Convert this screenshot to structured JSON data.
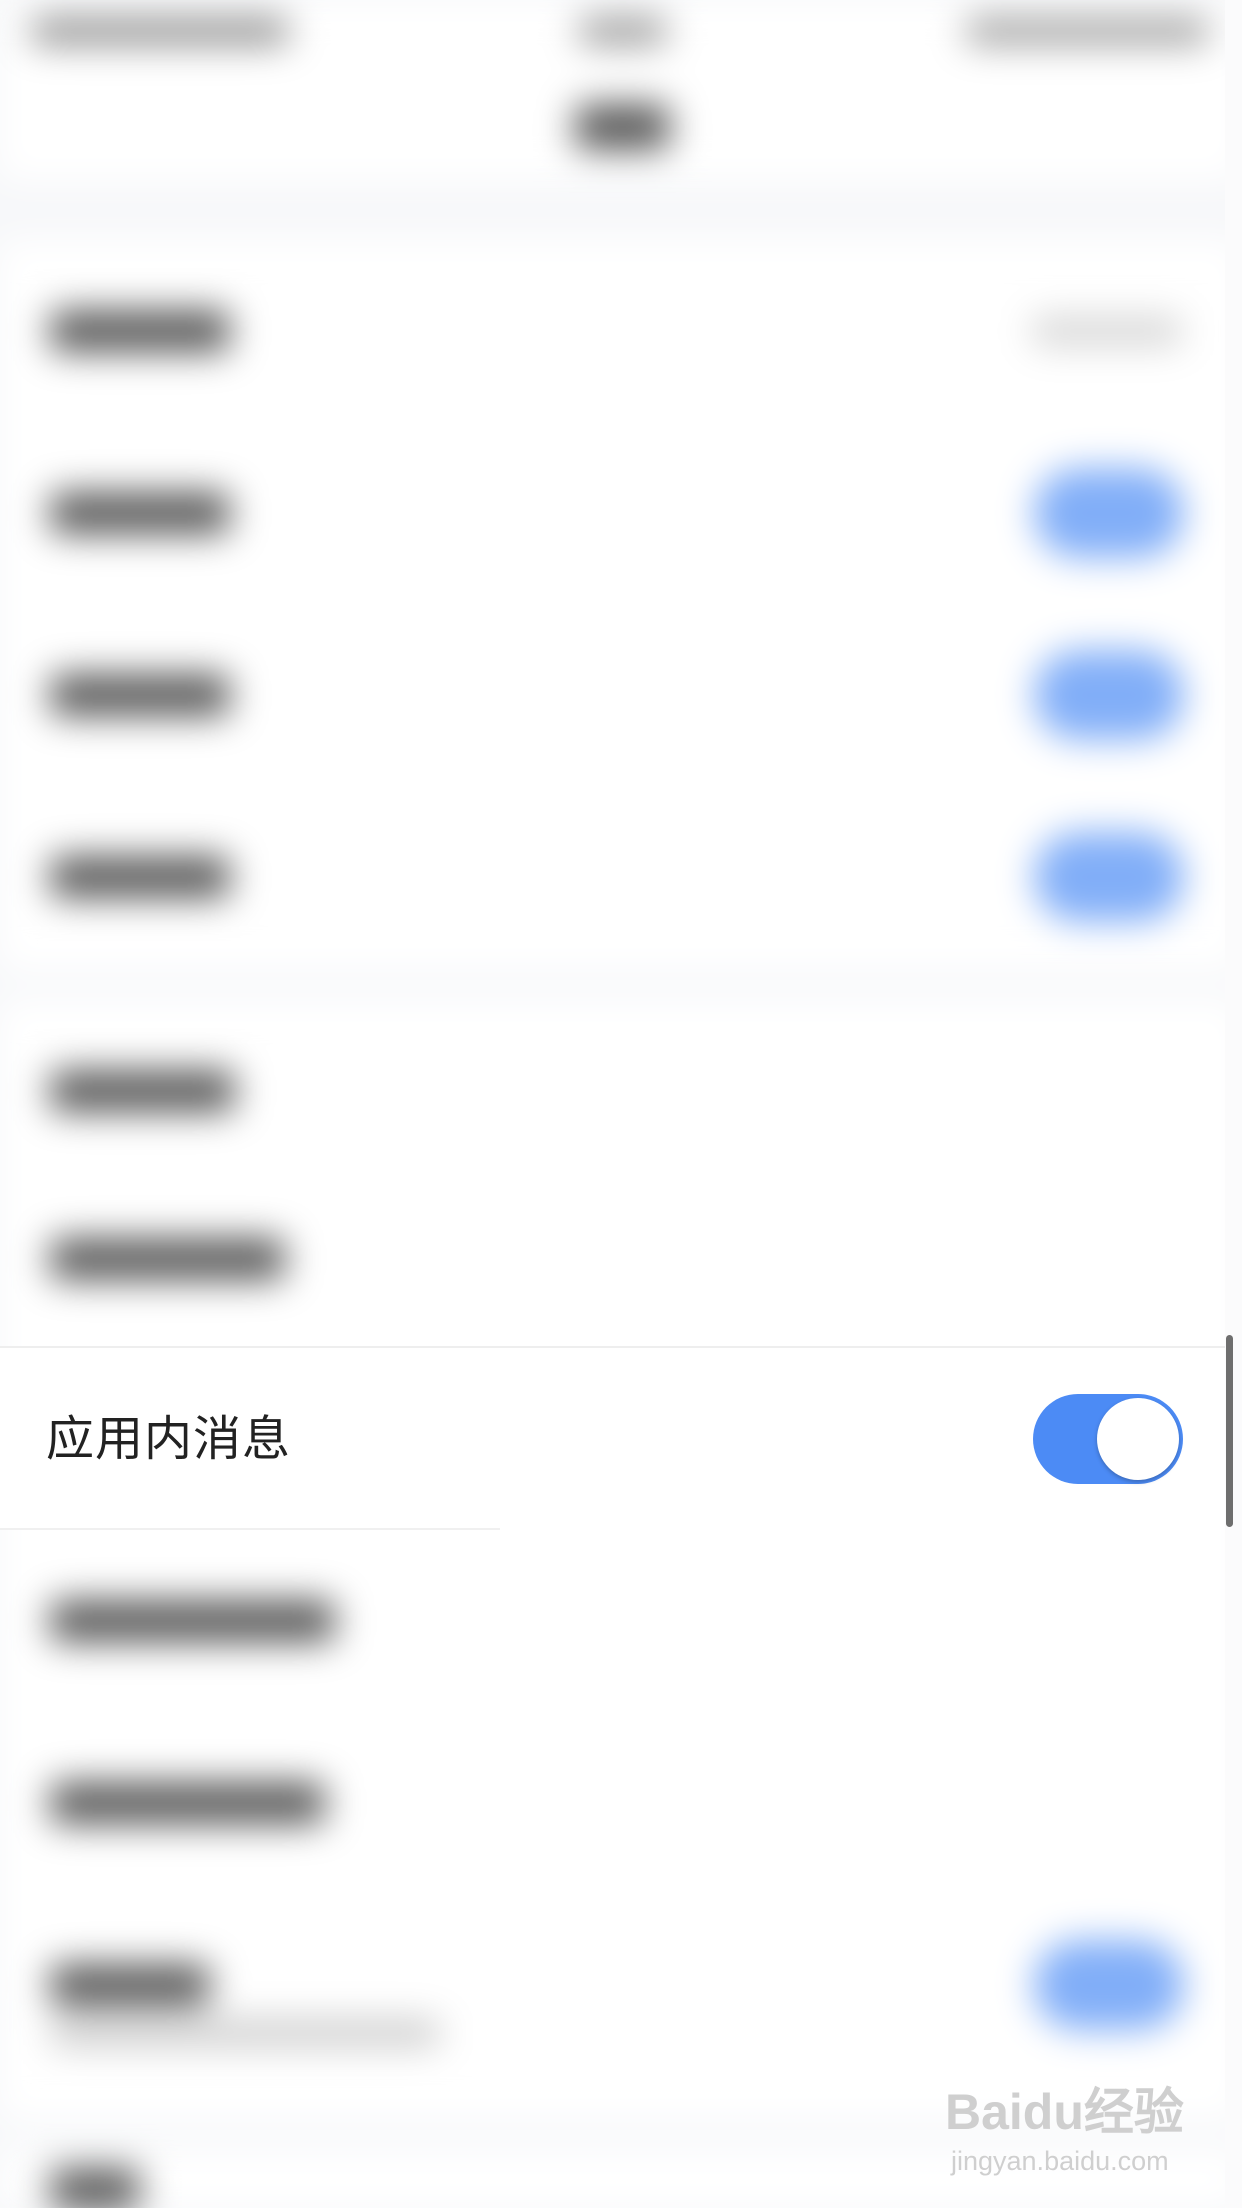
{
  "focused_setting": {
    "label": "应用内消息",
    "toggle_on": true
  },
  "watermark": {
    "logo_text": "Baidu经验",
    "url": "jingyan.baidu.com"
  },
  "colors": {
    "accent": "#4c8bf5",
    "background": "#f7f8fa",
    "row_background": "#ffffff",
    "text": "#222222"
  }
}
